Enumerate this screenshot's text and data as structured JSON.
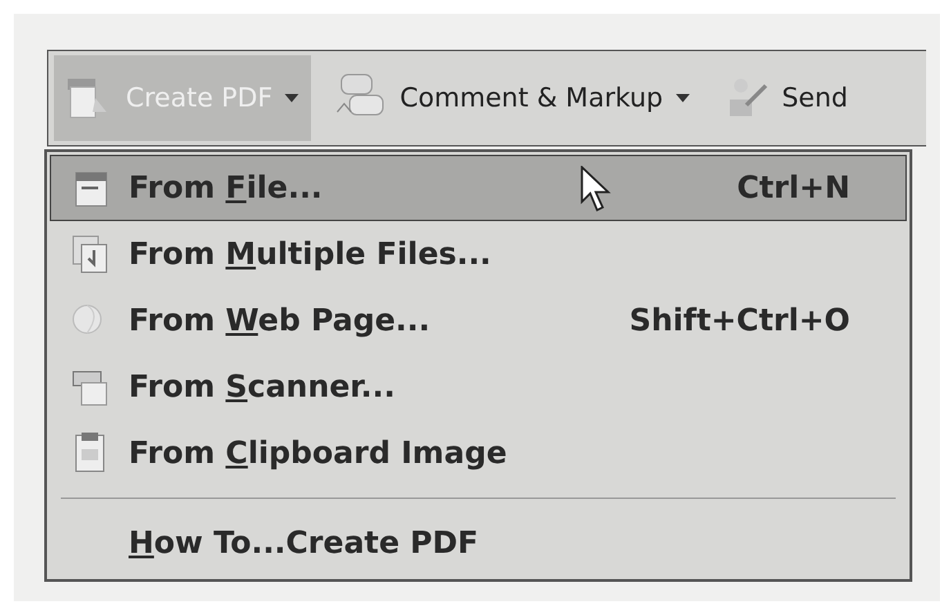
{
  "toolbar": {
    "buttons": [
      {
        "label": "Create PDF",
        "pressed": true,
        "dropdown": true
      },
      {
        "label": "Comment & Markup",
        "pressed": false,
        "dropdown": true
      },
      {
        "label": "Send",
        "pressed": false,
        "dropdown": false
      }
    ]
  },
  "menu": {
    "items": [
      {
        "kind": "command",
        "prefix": "From ",
        "access_key": "F",
        "rest": "ile...",
        "shortcut": "Ctrl+N",
        "selected": true
      },
      {
        "kind": "command",
        "prefix": "From ",
        "access_key": "M",
        "rest": "ultiple Files...",
        "selected": false
      },
      {
        "kind": "command",
        "prefix": "From ",
        "access_key": "W",
        "rest": "eb Page...",
        "shortcut": "Shift+Ctrl+O",
        "selected": false
      },
      {
        "kind": "command",
        "prefix": "From ",
        "access_key": "S",
        "rest": "canner...",
        "selected": false
      },
      {
        "kind": "command",
        "prefix": "From ",
        "access_key": "C",
        "rest": "lipboard Image",
        "selected": false
      },
      {
        "kind": "separator"
      },
      {
        "kind": "help",
        "access_key": "H",
        "rest": "ow To...Create PDF",
        "selected": false
      }
    ]
  }
}
